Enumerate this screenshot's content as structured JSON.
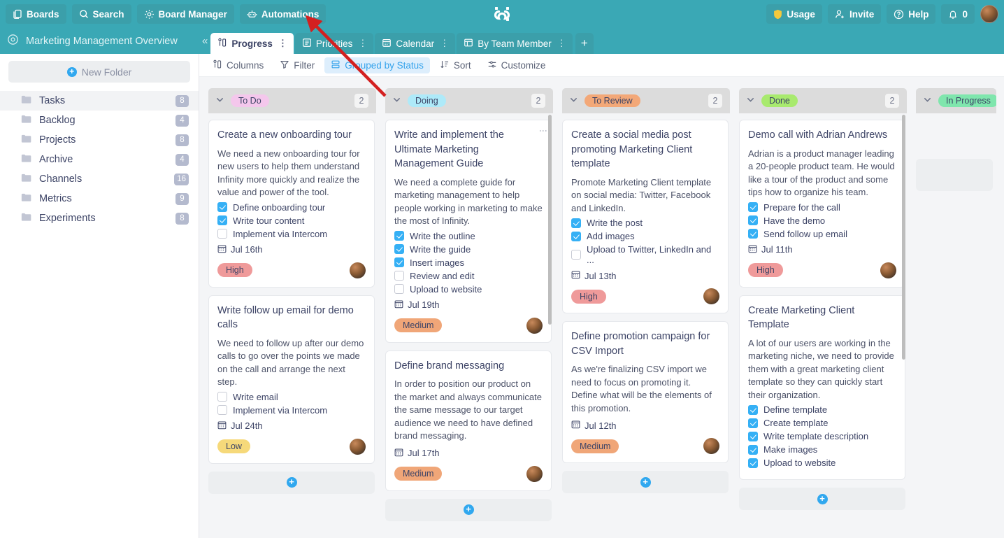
{
  "topbar": {
    "buttons": [
      {
        "label": "Boards",
        "icon": "boards-icon"
      },
      {
        "label": "Search",
        "icon": "search-icon"
      },
      {
        "label": "Board Manager",
        "icon": "gear-icon"
      },
      {
        "label": "Automations",
        "icon": "robot-icon"
      }
    ],
    "usage_label": "Usage",
    "invite_label": "Invite",
    "help_label": "Help",
    "notification_count": "0",
    "brand_color": "#3aa8b5"
  },
  "secondbar": {
    "board_title": "Marketing Management Overview",
    "collapse_label": "«",
    "tabs": [
      {
        "label": "Progress",
        "icon": "kanban-icon",
        "active": true
      },
      {
        "label": "Priorities",
        "icon": "list-icon",
        "active": false
      },
      {
        "label": "Calendar",
        "icon": "calendar-icon",
        "active": false
      },
      {
        "label": "By Team Member",
        "icon": "table-icon",
        "active": false
      }
    ],
    "add_tab_label": "+"
  },
  "sidebar": {
    "new_folder_label": "New Folder",
    "folders": [
      {
        "label": "Tasks",
        "count": "8",
        "selected": true
      },
      {
        "label": "Backlog",
        "count": "4",
        "selected": false
      },
      {
        "label": "Projects",
        "count": "8",
        "selected": false
      },
      {
        "label": "Archive",
        "count": "4",
        "selected": false
      },
      {
        "label": "Channels",
        "count": "16",
        "selected": false
      },
      {
        "label": "Metrics",
        "count": "9",
        "selected": false
      },
      {
        "label": "Experiments",
        "count": "8",
        "selected": false
      }
    ]
  },
  "toolbar": {
    "items": [
      {
        "label": "Columns",
        "icon": "columns-icon",
        "active": false
      },
      {
        "label": "Filter",
        "icon": "funnel-icon",
        "active": false
      },
      {
        "label": "Grouped by Status",
        "icon": "group-icon",
        "active": true
      },
      {
        "label": "Sort",
        "icon": "sort-icon",
        "active": false
      },
      {
        "label": "Customize",
        "icon": "sliders-icon",
        "active": false
      }
    ]
  },
  "board": {
    "add_card_label": "+",
    "columns": [
      {
        "status": "To Do",
        "status_color": "#f4c7ec",
        "count": "2",
        "cards": [
          {
            "title": "Create a new onboarding tour",
            "desc": "We need a new onboarding tour for new users to help them understand Infinity more quickly and realize the value and power of the tool.",
            "checklist": [
              {
                "label": "Define onboarding tour",
                "checked": true
              },
              {
                "label": "Write tour content",
                "checked": true
              },
              {
                "label": "Implement via Intercom",
                "checked": false
              }
            ],
            "date": "Jul 16th",
            "priority": "High",
            "priority_color": "#ef9a9a",
            "has_avatar": true,
            "has_dots": false
          },
          {
            "title": "Write follow up email for demo calls",
            "desc": "We need to follow up after our demo calls to go over the points we made on the call and arrange the next step.",
            "checklist": [
              {
                "label": "Write email",
                "checked": false
              },
              {
                "label": "Implement via Intercom",
                "checked": false
              }
            ],
            "date": "Jul 24th",
            "priority": "Low",
            "priority_color": "#f6d97a",
            "has_avatar": true,
            "has_dots": false
          }
        ]
      },
      {
        "status": "Doing",
        "status_color": "#aeeaf9",
        "count": "2",
        "cards": [
          {
            "title": "Write and implement the Ultimate Marketing Management Guide",
            "desc": "We need a complete guide for marketing management to help people working in marketing to make the most of Infinity.",
            "checklist": [
              {
                "label": "Write the outline",
                "checked": true
              },
              {
                "label": "Write the guide",
                "checked": true
              },
              {
                "label": "Insert images",
                "checked": true
              },
              {
                "label": "Review and edit",
                "checked": false
              },
              {
                "label": "Upload to website",
                "checked": false
              }
            ],
            "date": "Jul 19th",
            "priority": "Medium",
            "priority_color": "#f0a678",
            "has_avatar": true,
            "has_dots": true
          },
          {
            "title": "Define brand messaging",
            "desc": "In order to position our product on the market and always communicate the same message to our target audience we need to have defined brand messaging.",
            "checklist": [],
            "date": "Jul 17th",
            "priority": "Medium",
            "priority_color": "#f0a678",
            "has_avatar": true,
            "has_dots": false
          }
        ]
      },
      {
        "status": "To Review",
        "status_color": "#f3a878",
        "count": "2",
        "cards": [
          {
            "title": "Create a social media post promoting Marketing Client template",
            "desc": "Promote Marketing Client template on social media: Twitter, Facebook and LinkedIn.",
            "checklist": [
              {
                "label": "Write the post",
                "checked": true
              },
              {
                "label": "Add images",
                "checked": true
              },
              {
                "label": "Upload to Twitter, LinkedIn and ...",
                "checked": false
              }
            ],
            "date": "Jul 13th",
            "priority": "High",
            "priority_color": "#ef9a9a",
            "has_avatar": true,
            "has_dots": false
          },
          {
            "title": "Define promotion campaign for CSV Import",
            "desc": "As we're finalizing CSV import we need to focus on promoting it. Define what will be the elements of this promotion.",
            "checklist": [],
            "date": "Jul 12th",
            "priority": "Medium",
            "priority_color": "#f0a678",
            "has_avatar": true,
            "has_dots": false
          }
        ]
      },
      {
        "status": "Done",
        "status_color": "#a8ea6e",
        "count": "2",
        "cards": [
          {
            "title": "Demo call with Adrian Andrews",
            "desc": "Adrian is a product manager leading a 20-people product team. He would like a tour of the product and some tips how to organize his team.",
            "checklist": [
              {
                "label": "Prepare for the call",
                "checked": true
              },
              {
                "label": "Have the demo",
                "checked": true
              },
              {
                "label": "Send follow up email",
                "checked": true
              }
            ],
            "date": "Jul 11th",
            "priority": "High",
            "priority_color": "#ef9a9a",
            "has_avatar": true,
            "has_dots": false
          },
          {
            "title": "Create Marketing Client Template",
            "desc": "A lot of our users are working in the marketing niche, we need to provide them with a great marketing client template so they can quickly start their organization.",
            "checklist": [
              {
                "label": "Define template",
                "checked": true
              },
              {
                "label": "Create template",
                "checked": true
              },
              {
                "label": "Write template description",
                "checked": true
              },
              {
                "label": "Make images",
                "checked": true
              },
              {
                "label": "Upload to website",
                "checked": true
              }
            ],
            "date": "",
            "priority": "",
            "priority_color": "",
            "has_avatar": false,
            "has_dots": false
          }
        ]
      },
      {
        "status": "In Progress",
        "status_color": "#7fe6ad",
        "count": "",
        "cards": []
      }
    ]
  },
  "annotation": {
    "arrow_color": "#d32020"
  }
}
